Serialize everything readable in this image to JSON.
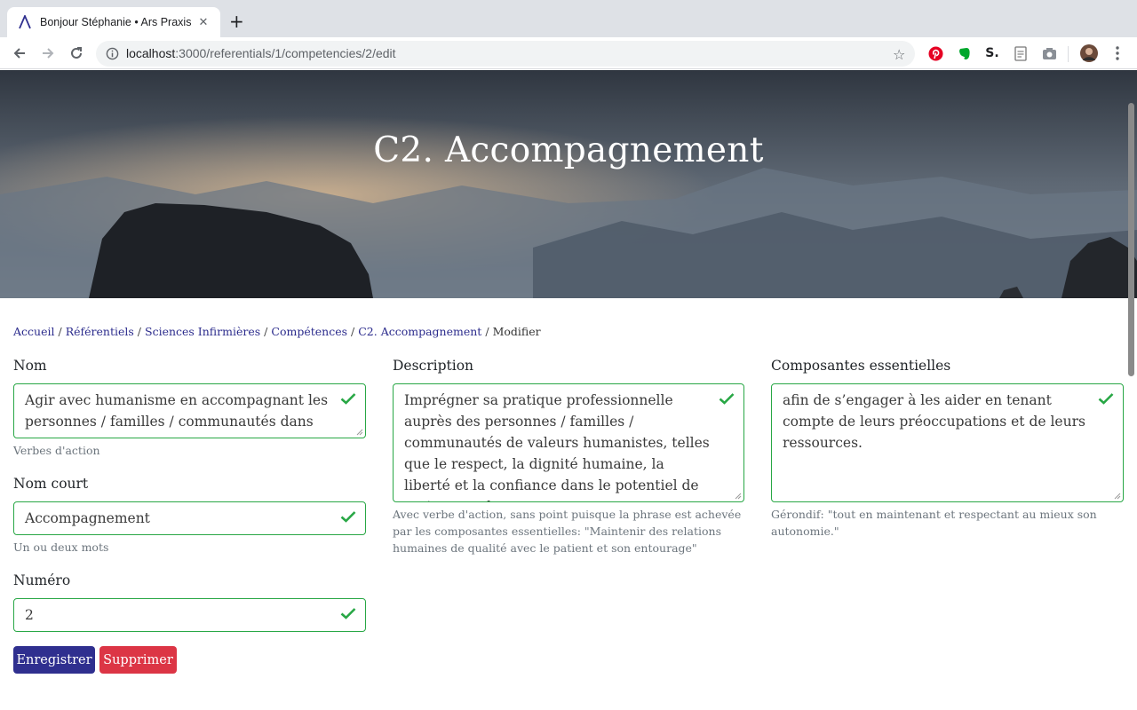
{
  "browser": {
    "tab_title": "Bonjour Stéphanie • Ars Praxis",
    "tab_close": "✕",
    "new_tab": "+",
    "url_host": "localhost",
    "url_path": ":3000/referentials/1/competencies/2/edit",
    "icons": [
      "back-icon",
      "forward-icon",
      "reload-icon",
      "info-icon",
      "star-icon",
      "pinterest-icon",
      "evernote-icon",
      "s-extension-icon",
      "document-icon",
      "camera-icon",
      "avatar-icon",
      "menu-icon"
    ],
    "ext_s_label": "S."
  },
  "hero": {
    "title": "C2. Accompagnement"
  },
  "breadcrumb": {
    "items": [
      "Accueil",
      "Référentiels",
      "Sciences Infirmières",
      "Compétences",
      "C2. Accompagnement"
    ],
    "current": "Modifier",
    "separator": "/"
  },
  "form": {
    "nom": {
      "label": "Nom",
      "value": "Agir avec humanisme en accompagnant les personnes / familles / communautés dans",
      "hint": "Verbes d'action"
    },
    "nom_court": {
      "label": "Nom court",
      "value": "Accompagnement",
      "hint": "Un ou deux mots"
    },
    "numero": {
      "label": "Numéro",
      "value": "2"
    },
    "description": {
      "label": "Description",
      "value": "Imprégner sa pratique professionnelle auprès des personnes / familles / communautés de valeurs humanistes, telles que le respect, la dignité humaine, la liberté et la confiance dans le potentiel de croissance des personnes,",
      "hint": "Avec verbe d'action, sans point puisque la phrase est achevée par les composantes essentielles: \"Maintenir des relations humaines de qualité avec le patient et son entourage\""
    },
    "composantes": {
      "label": "Composantes essentielles",
      "value": "afin de s’engager à les aider en tenant compte de leurs préoccupations et de leurs ressources.",
      "hint": "Gérondif: \"tout en maintenant et respectant au mieux son autonomie.\""
    },
    "save_label": "Enregistrer",
    "delete_label": "Supprimer"
  },
  "colors": {
    "valid": "#28a745",
    "primary": "#2f2f8f",
    "danger": "#dc3545",
    "link": "#2b2b8c"
  }
}
